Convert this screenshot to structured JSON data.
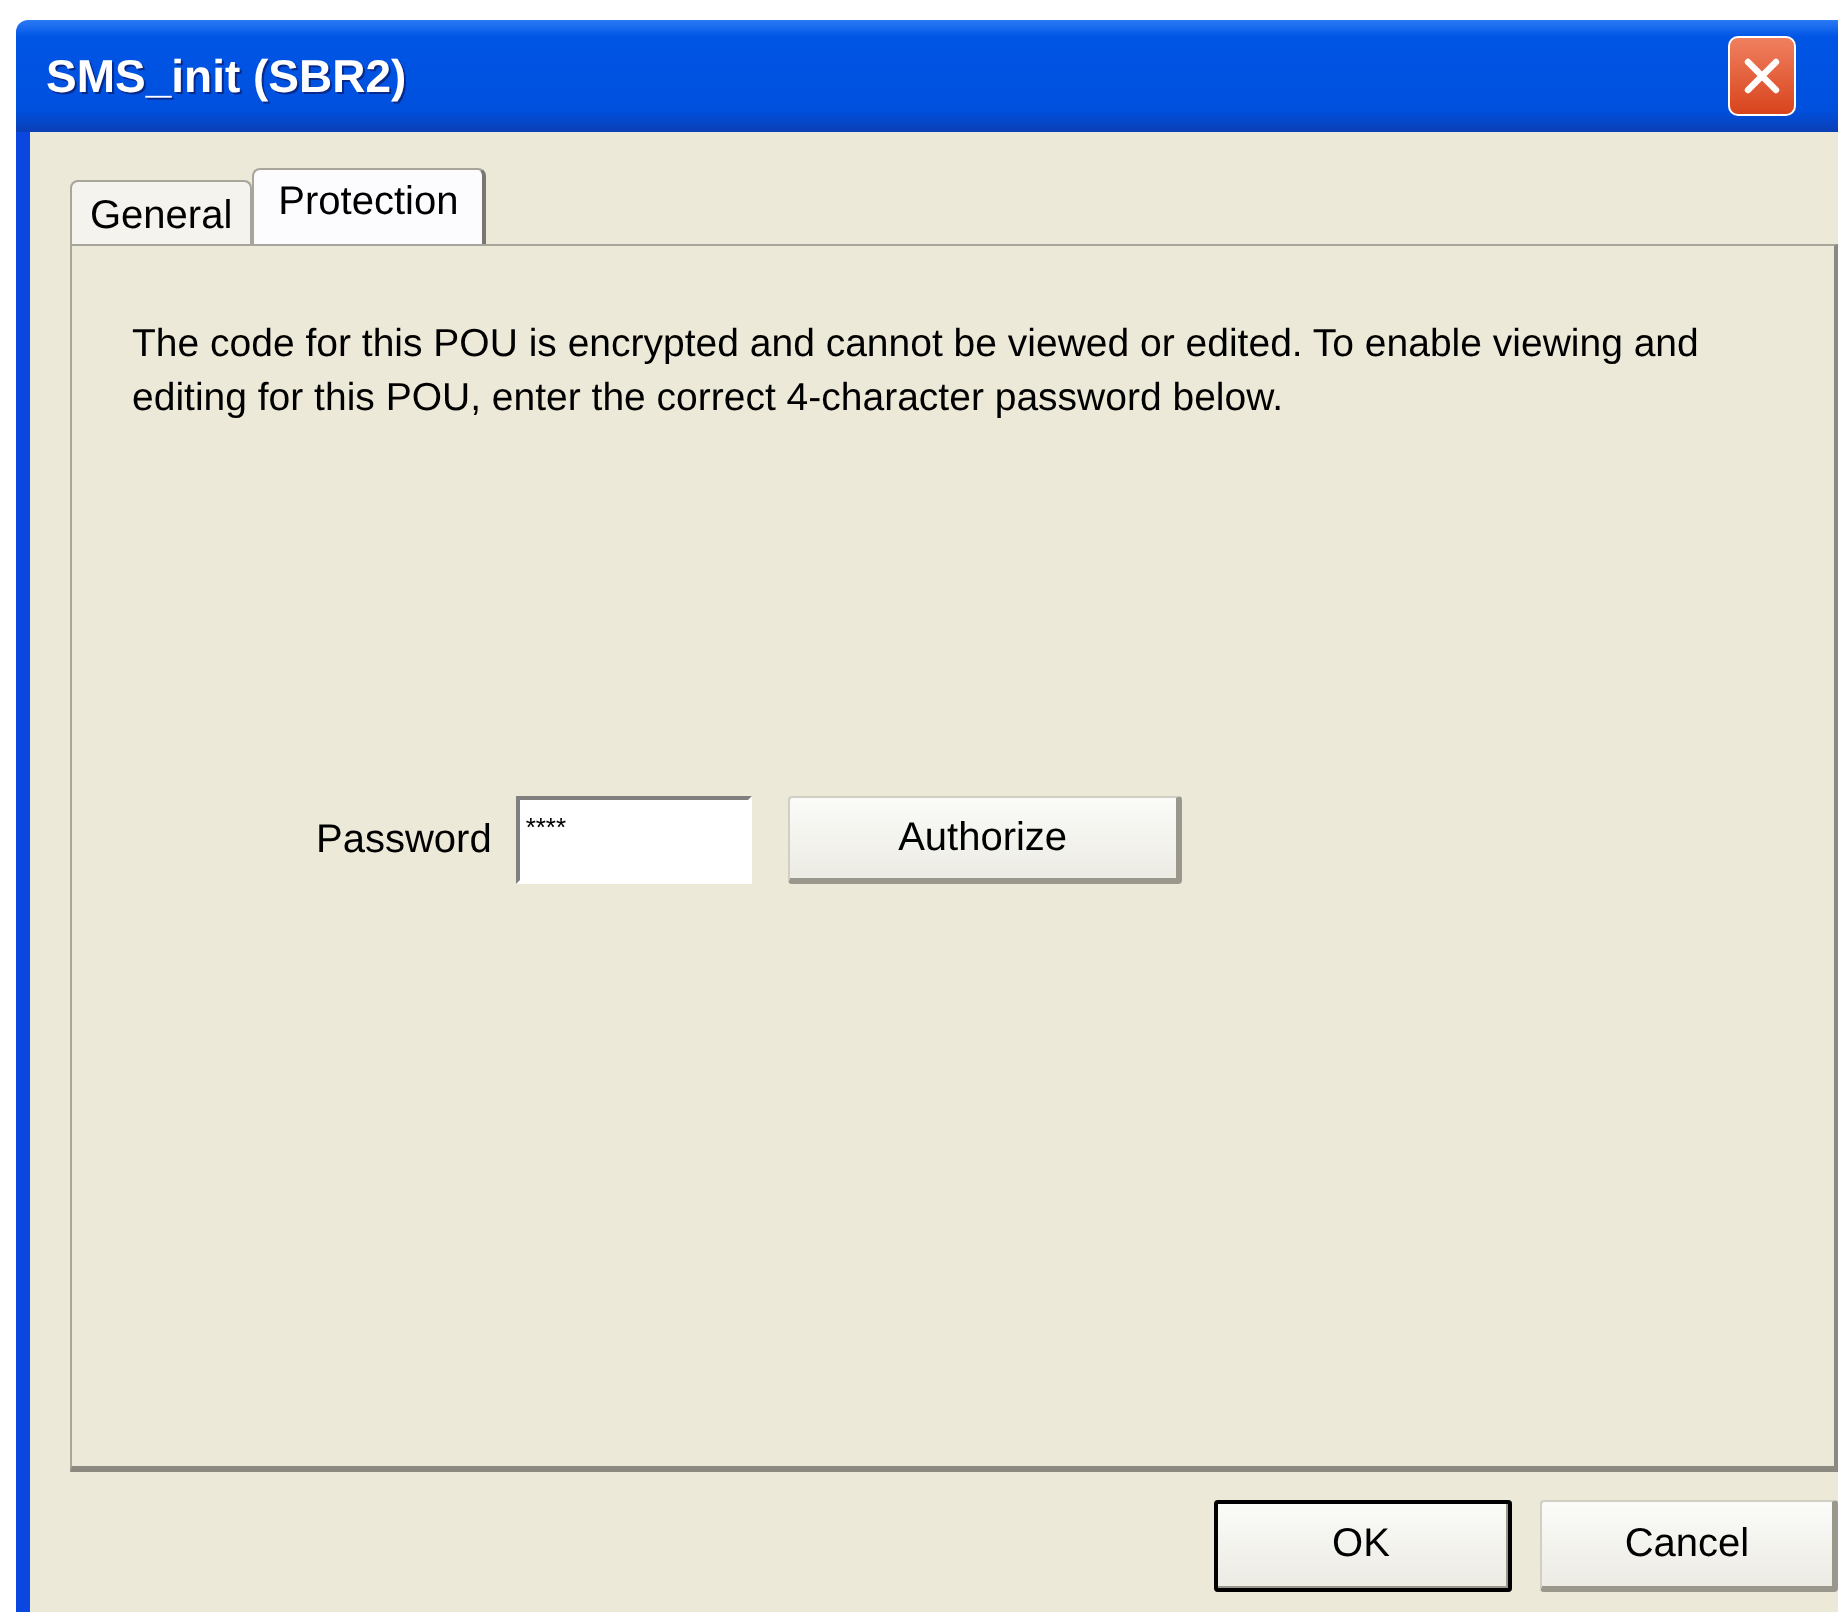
{
  "window": {
    "title": "SMS_init (SBR2)"
  },
  "tabs": [
    {
      "label": "General",
      "selected": false
    },
    {
      "label": "Protection",
      "selected": true
    }
  ],
  "message": "The code for this POU is encrypted and cannot be viewed or edited.  To enable viewing and editing for this POU, enter the correct 4-character password below.",
  "password": {
    "label": "Password",
    "value": "****",
    "button": "Authorize"
  },
  "buttons": [
    {
      "label": "OK",
      "default": true
    },
    {
      "label": "Cancel",
      "default": false
    }
  ]
}
